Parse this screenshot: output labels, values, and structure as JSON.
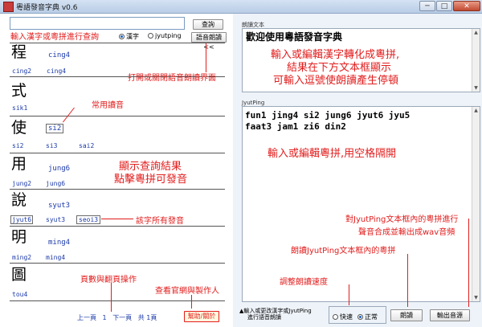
{
  "window": {
    "title": "粵語發音字典 v0.6",
    "minimize": "─",
    "maximize": "□",
    "close": "✕"
  },
  "search": {
    "annotation": "輸入漢字或粵拼進行查詢",
    "query_button": "查詢",
    "voice_toggle_button": "語音朗讀<<",
    "mode_hanzi": "漢字",
    "mode_jyutping": "jyutping"
  },
  "results": [
    {
      "char": "程",
      "main": "cing4",
      "readings": [
        "cing2",
        "cing4"
      ]
    },
    {
      "char": "式",
      "main": "",
      "readings": [
        "sik1"
      ]
    },
    {
      "char": "使",
      "main": "si2",
      "readings": [
        "si2",
        "si3",
        "sai2"
      ]
    },
    {
      "char": "用",
      "main": "jung6",
      "readings": [
        "jung2",
        "jung6"
      ]
    },
    {
      "char": "說",
      "main": "syut3",
      "readings": [
        "jyut6",
        "syut3",
        "seoi3"
      ]
    },
    {
      "char": "明",
      "main": "ming4",
      "readings": [
        "ming2",
        "ming4"
      ]
    },
    {
      "char": "圖",
      "main": "",
      "readings": [
        "tou4"
      ]
    }
  ],
  "annotations": {
    "toggle_panel": "打開或關閉語音朗讀界面",
    "common_reading": "常用讀音",
    "show_results_1": "顯示查詢結果",
    "show_results_2": "點擊粵拼可發音",
    "all_readings": "該字所有發音",
    "paging": "頁數與翻頁操作",
    "website": "查看官網與製作人",
    "speed": "調整朗讀速度",
    "read_jyutping": "朗讀JyutPing文本框內的粵拼",
    "export_1": "對JyutPing文本框內的粵拼進行",
    "export_2": "聲音合成並輸出成wav音頻",
    "reading_box_1": "輸入或編輯漢字轉化成粵拼,",
    "reading_box_2": "結果在下方文本框顯示",
    "reading_box_3": "可輸入逗號使朗讀產生停頓",
    "jyutping_box": "輸入或編輯粵拼,用空格隔開"
  },
  "pager": {
    "prev": "上一頁",
    "page": "1",
    "next": "下一頁",
    "total": "共 1頁"
  },
  "help_button": "幫助/關於",
  "reading_panel": {
    "label": "朗讀文本",
    "text": "歡迎使用粵語發音字典",
    "jyutping_label": "JyutPing",
    "jyutping_line1": "fun1 jing4 si2 jung6 jyut6 jyu5",
    "jyutping_line2": "faat3 jam1 zi6 din2"
  },
  "bottom": {
    "hint_1": "▲輸入或更改漢字或JyutPing",
    "hint_2": "進行語音朗讀",
    "speed_fast": "快速",
    "speed_normal": "正常",
    "read_button": "朗讀",
    "export_button": "輸出音源"
  },
  "colors": {
    "annotation": "#e21d1d",
    "jyutping": "#1b3aa8"
  }
}
